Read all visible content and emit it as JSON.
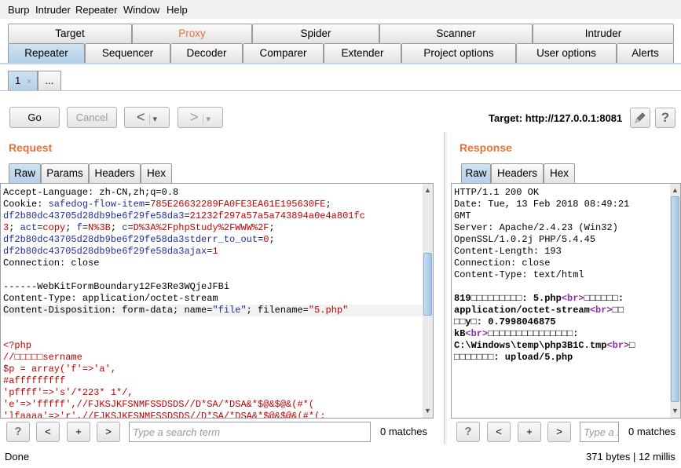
{
  "menu": [
    "Burp",
    "Intruder",
    "Repeater",
    "Window",
    "Help"
  ],
  "top_tabs_row1": [
    "Target",
    "Proxy",
    "Spider",
    "Scanner",
    "Intruder"
  ],
  "top_tabs_row2": [
    "Repeater",
    "Sequencer",
    "Decoder",
    "Comparer",
    "Extender",
    "Project options",
    "User options",
    "Alerts"
  ],
  "repeater_tabs": {
    "tab1": "1",
    "close": "×",
    "more": "..."
  },
  "toolbar": {
    "go": "Go",
    "cancel": "Cancel",
    "back": "<",
    "forward": ">",
    "dropdown": "▾",
    "target": "Target: http://127.0.0.1:8081",
    "help": "?"
  },
  "request": {
    "title": "Request",
    "tabs": [
      "Raw",
      "Params",
      "Headers",
      "Hex"
    ],
    "search_placeholder": "Type a search term",
    "matches": "0 matches"
  },
  "response": {
    "title": "Response",
    "tabs": [
      "Raw",
      "Headers",
      "Hex"
    ],
    "search_placeholder": "Type a search term",
    "matches": "0 matches"
  },
  "search_buttons": {
    "help": "?",
    "prev": "<",
    "add": "+",
    "next": ">"
  },
  "status": {
    "left": "Done",
    "right": "371 bytes | 12 millis"
  }
}
